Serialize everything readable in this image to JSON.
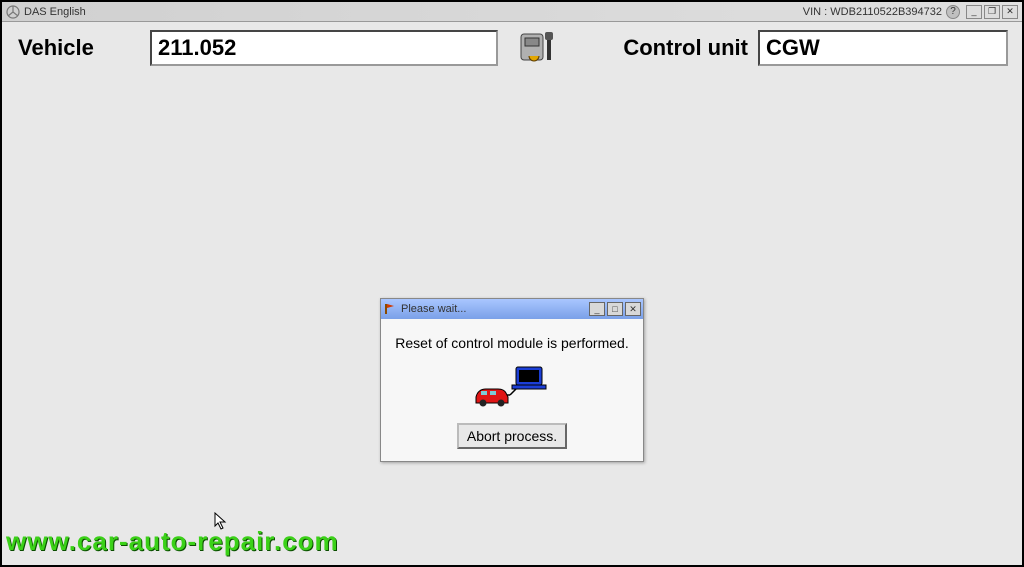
{
  "app": {
    "title": "DAS English",
    "vin_label": "VIN : WDB2110522B394732"
  },
  "header": {
    "vehicle_label": "Vehicle",
    "vehicle_value": "211.052",
    "control_unit_label": "Control unit",
    "control_unit_value": "CGW"
  },
  "dialog": {
    "title": "Please wait...",
    "message": "Reset of control module is performed.",
    "abort_label": "Abort process."
  },
  "watermark": "www.car-auto-repair.com",
  "icons": {
    "app_icon": "mercedes-logo-icon",
    "center_icon": "ecu-connector-icon",
    "dialog_icon": "flag-icon",
    "car_icon": "red-car-icon",
    "laptop_icon": "laptop-icon"
  }
}
